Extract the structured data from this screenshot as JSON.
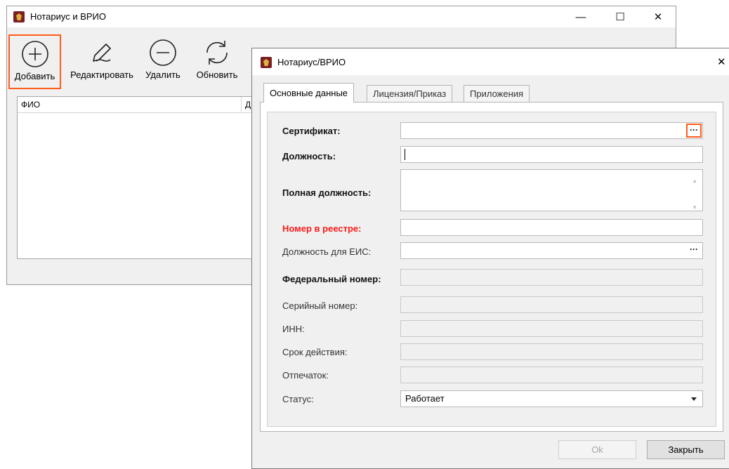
{
  "main_window": {
    "title": "Нотариус и ВРИО",
    "controls": {
      "minimize": "—",
      "maximize": "☐",
      "close": "✕"
    },
    "toolbar": {
      "add_label": "Добавить",
      "edit_label": "Редактировать",
      "delete_label": "Удалить",
      "refresh_label": "Обновить"
    },
    "table": {
      "columns": [
        "ФИО",
        "Д"
      ]
    }
  },
  "dialog": {
    "title": "Нотариус/ВРИО",
    "close_glyph": "✕",
    "tabs": [
      "Основные данные",
      "Лицензия/Приказ",
      "Приложения"
    ],
    "active_tab": "Основные данные",
    "fields": {
      "certificate": {
        "label": "Сертификат:",
        "value": "",
        "button": "···"
      },
      "position": {
        "label": "Должность:",
        "value": ""
      },
      "full_position": {
        "label": "Полная должность:",
        "value": ""
      },
      "registry_number": {
        "label": "Номер в реестре:",
        "value": ""
      },
      "eis_position": {
        "label": "Должность для ЕИС:",
        "value": "",
        "button": "···"
      },
      "federal_number": {
        "label": "Федеральный номер:",
        "value": ""
      },
      "serial_number": {
        "label": "Серийный номер:",
        "value": ""
      },
      "inn": {
        "label": "ИНН:",
        "value": ""
      },
      "validity": {
        "label": "Срок действия:",
        "value": ""
      },
      "fingerprint": {
        "label": "Отпечаток:",
        "value": ""
      },
      "status": {
        "label": "Статус:",
        "value": "Работает"
      }
    },
    "buttons": {
      "ok": "Ok",
      "close": "Закрыть"
    }
  },
  "colors": {
    "highlight": "#ff5c1a",
    "required_label": "#ff1a1a",
    "app_icon": "#7a1f24"
  }
}
